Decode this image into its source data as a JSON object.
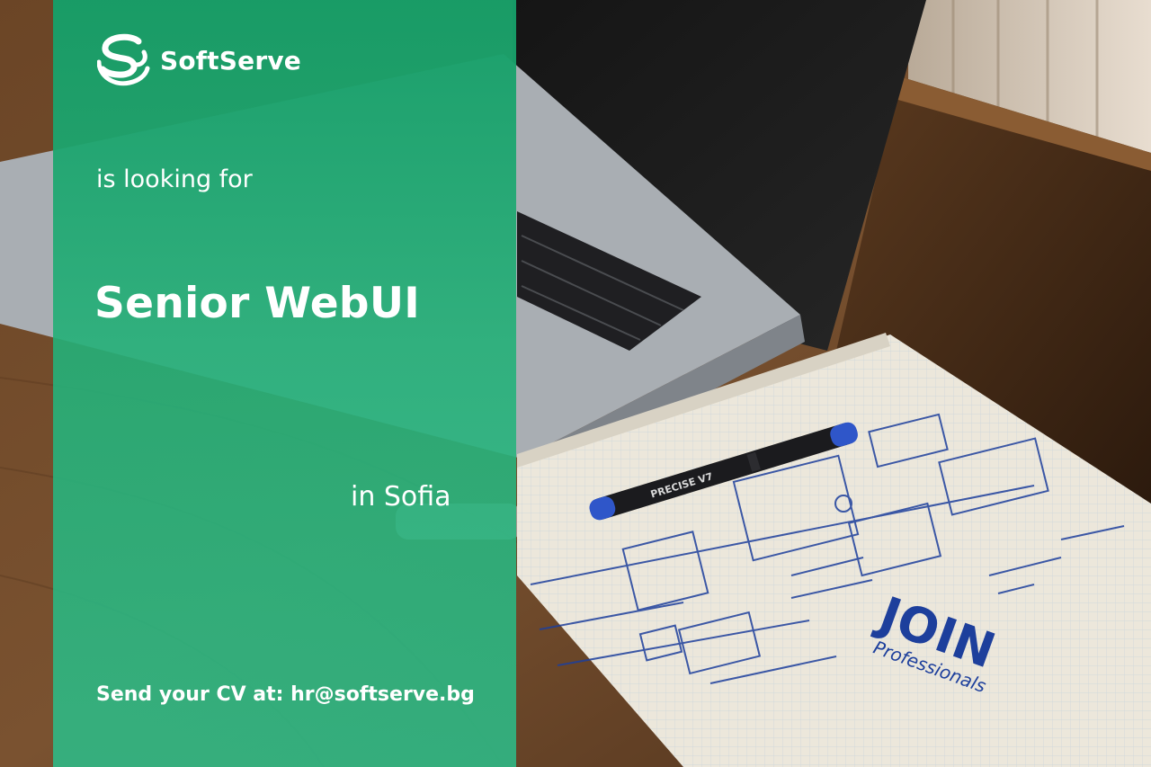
{
  "brand": {
    "name": "SoftServe",
    "logo_icon": "softserve-s-logo-icon"
  },
  "ad": {
    "intro": "is looking for",
    "position": "Senior WebUI",
    "location": "in Sofia",
    "cta_prefix": "Send your CV at:",
    "cta_email": "hr@softserve.bg"
  },
  "notebook": {
    "stamp_main": "JOIN",
    "stamp_sub": "Professionals",
    "pen_label": "PRECISE V7"
  },
  "colors": {
    "panel_green": "#169e68",
    "panel_green_light": "#2cbe8a",
    "text": "#ffffff",
    "sketch_ink": "#1d3f9c",
    "pen_cap_blue": "#2f56c9"
  }
}
